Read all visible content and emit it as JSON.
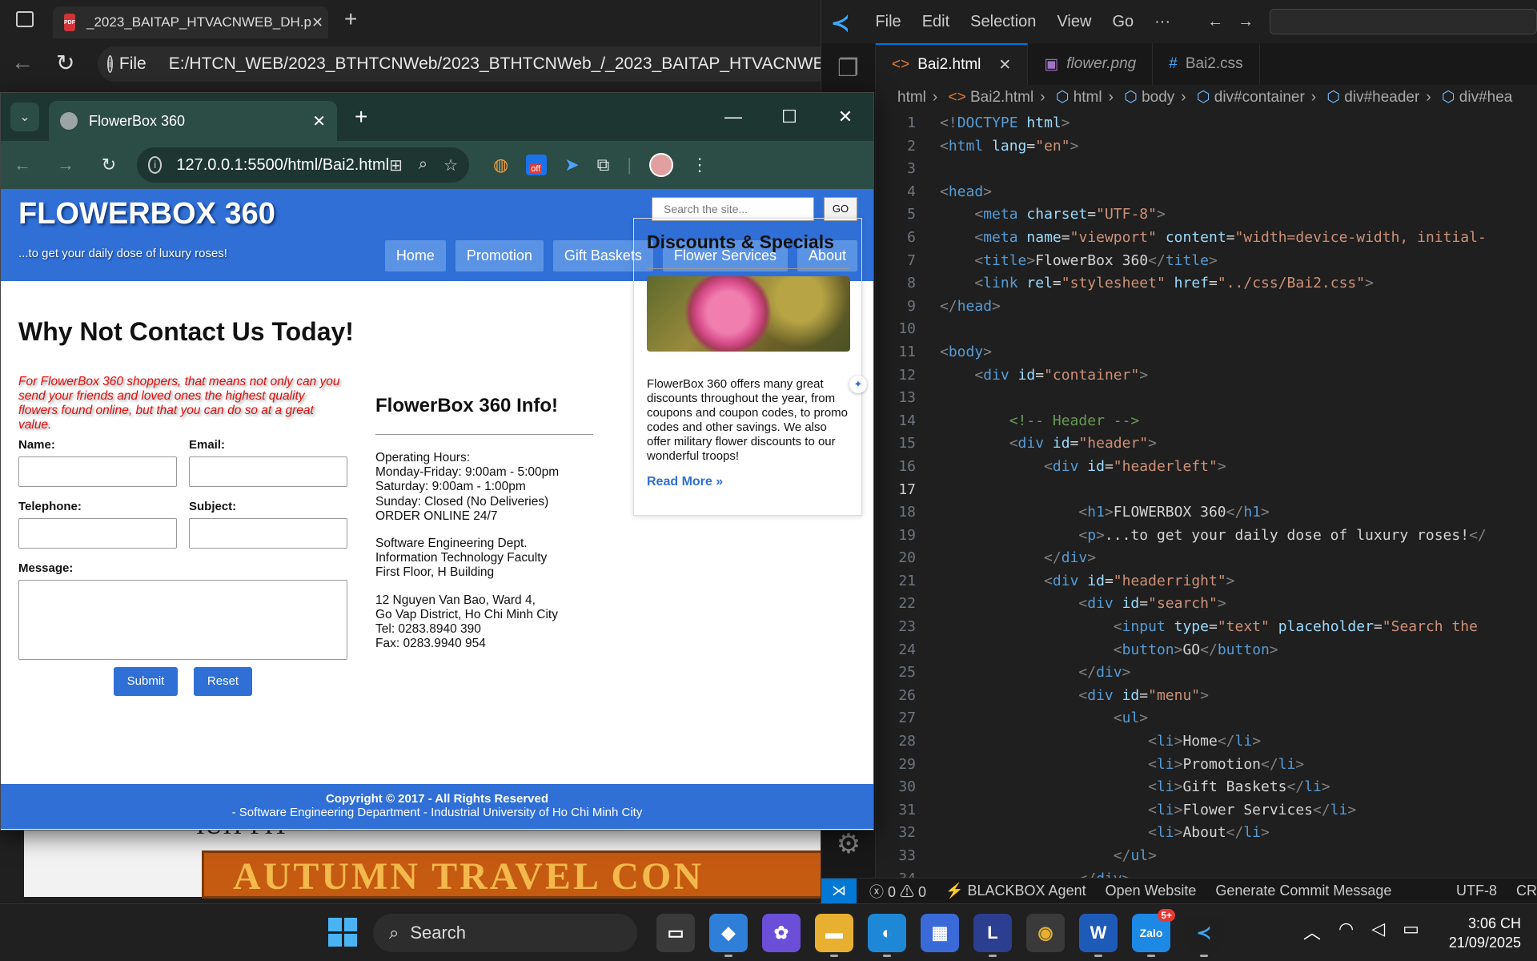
{
  "edge_bg": {
    "tab_title": "_2023_BAITAP_HTVACNWEB_DH.p",
    "pdf_badge": "PDF",
    "address": "E:/HTCN_WEB/2023_BTHTCNWeb/2023_BTHTCNWeb_/_2023_BAITAP_HTVACNWEB_DH.p",
    "address_prefix": "File",
    "pdf_text_fragment": "IUH-FIT",
    "pdf_banner": "AUTUMN TRAVEL CON"
  },
  "chrome": {
    "tab_title": "FlowerBox 360",
    "url": "127.0.0.1:5500/html/Bai2.html",
    "ext_badge": "off"
  },
  "site": {
    "title": "FLOWERBOX 360",
    "tagline": "...to get your daily dose of luxury roses!",
    "search_placeholder": "Search the site...",
    "go_label": "GO",
    "menu": [
      "Home",
      "Promotion",
      "Gift Baskets",
      "Flower Services",
      "About"
    ],
    "heading": "Why Not Contact Us Today!",
    "intro": "For FlowerBox 360 shoppers, that means not only can you send your friends and loved ones the highest quality flowers found online, but that you can do so at a great value.",
    "form": {
      "name_label": "Name:",
      "email_label": "Email:",
      "telephone_label": "Telephone:",
      "subject_label": "Subject:",
      "message_label": "Message:",
      "submit": "Submit",
      "reset": "Reset"
    },
    "info_title": "FlowerBox 360 Info!",
    "hours": [
      "Operating Hours:",
      "Monday-Friday: 9:00am - 5:00pm",
      "Saturday: 9:00am - 1:00pm",
      "Sunday: Closed (No Deliveries)",
      "ORDER ONLINE 24/7"
    ],
    "dept": [
      "Software Engineering Dept.",
      "Information Technology Faculty",
      "First Floor, H Building"
    ],
    "address": [
      "12 Nguyen Van Bao, Ward 4,",
      "Go Vap District, Ho Chi Minh City",
      "Tel: 0283.8940 390",
      "Fax: 0283.9940 954"
    ],
    "side_title": "Discounts & Specials",
    "side_text": "FlowerBox 360 offers many great discounts throughout the year, from coupons and coupon codes, to promo codes and other savings. We also offer military flower discounts to our wonderful troops!",
    "read_more": "Read More »",
    "footer_line1": "Copyright © 2017 - All Rights Reserved",
    "footer_line2": "- Software Engineering Department - Industrial University of Ho Chi Minh City"
  },
  "vscode": {
    "menu": [
      "File",
      "Edit",
      "Selection",
      "View",
      "Go",
      "···"
    ],
    "tabs": [
      {
        "label": "Bai2.html",
        "icon": "<>"
      },
      {
        "label": "flower.png",
        "icon": "▣"
      },
      {
        "label": "Bai2.css",
        "icon": "#"
      }
    ],
    "breadcrumb": [
      "html",
      "Bai2.html",
      "html",
      "body",
      "div#container",
      "div#header",
      "div#hea"
    ],
    "current_line": 17,
    "status": {
      "errors": "0",
      "warnings": "0",
      "agent": "BLACKBOX Agent",
      "open_website": "Open Website",
      "commit": "Generate Commit Message",
      "encoding": "UTF-8",
      "eol": "CR"
    },
    "code": [
      {
        "n": 1,
        "s": [
          [
            "br",
            "<!"
          ],
          [
            "tag",
            "DOCTYPE"
          ],
          [
            "txt",
            " "
          ],
          [
            "attr",
            "html"
          ],
          [
            "br",
            ">"
          ]
        ]
      },
      {
        "n": 2,
        "s": [
          [
            "br",
            "<"
          ],
          [
            "tag",
            "html"
          ],
          [
            "txt",
            " "
          ],
          [
            "attr",
            "lang"
          ],
          [
            "txt",
            "="
          ],
          [
            "str",
            "\"en\""
          ],
          [
            "br",
            ">"
          ]
        ]
      },
      {
        "n": 3,
        "s": []
      },
      {
        "n": 4,
        "s": [
          [
            "br",
            "<"
          ],
          [
            "tag",
            "head"
          ],
          [
            "br",
            ">"
          ]
        ]
      },
      {
        "n": 5,
        "s": [
          [
            "txt",
            "    "
          ],
          [
            "br",
            "<"
          ],
          [
            "tag",
            "meta"
          ],
          [
            "txt",
            " "
          ],
          [
            "attr",
            "charset"
          ],
          [
            "txt",
            "="
          ],
          [
            "str",
            "\"UTF-8\""
          ],
          [
            "br",
            ">"
          ]
        ]
      },
      {
        "n": 6,
        "s": [
          [
            "txt",
            "    "
          ],
          [
            "br",
            "<"
          ],
          [
            "tag",
            "meta"
          ],
          [
            "txt",
            " "
          ],
          [
            "attr",
            "name"
          ],
          [
            "txt",
            "="
          ],
          [
            "str",
            "\"viewport\""
          ],
          [
            "txt",
            " "
          ],
          [
            "attr",
            "content"
          ],
          [
            "txt",
            "="
          ],
          [
            "str",
            "\"width=device-width, initial-"
          ]
        ]
      },
      {
        "n": 7,
        "s": [
          [
            "txt",
            "    "
          ],
          [
            "br",
            "<"
          ],
          [
            "tag",
            "title"
          ],
          [
            "br",
            ">"
          ],
          [
            "txt",
            "FlowerBox 360"
          ],
          [
            "br",
            "</"
          ],
          [
            "tag",
            "title"
          ],
          [
            "br",
            ">"
          ]
        ]
      },
      {
        "n": 8,
        "s": [
          [
            "txt",
            "    "
          ],
          [
            "br",
            "<"
          ],
          [
            "tag",
            "link"
          ],
          [
            "txt",
            " "
          ],
          [
            "attr",
            "rel"
          ],
          [
            "txt",
            "="
          ],
          [
            "str",
            "\"stylesheet\""
          ],
          [
            "txt",
            " "
          ],
          [
            "attr",
            "href"
          ],
          [
            "txt",
            "="
          ],
          [
            "str",
            "\"../css/Bai2.css\""
          ],
          [
            "br",
            ">"
          ]
        ]
      },
      {
        "n": 9,
        "s": [
          [
            "br",
            "</"
          ],
          [
            "tag",
            "head"
          ],
          [
            "br",
            ">"
          ]
        ]
      },
      {
        "n": 10,
        "s": []
      },
      {
        "n": 11,
        "s": [
          [
            "br",
            "<"
          ],
          [
            "tag",
            "body"
          ],
          [
            "br",
            ">"
          ]
        ]
      },
      {
        "n": 12,
        "s": [
          [
            "txt",
            "    "
          ],
          [
            "br",
            "<"
          ],
          [
            "tag",
            "div"
          ],
          [
            "txt",
            " "
          ],
          [
            "attr",
            "id"
          ],
          [
            "txt",
            "="
          ],
          [
            "str",
            "\"container\""
          ],
          [
            "br",
            ">"
          ]
        ]
      },
      {
        "n": 13,
        "s": []
      },
      {
        "n": 14,
        "s": [
          [
            "txt",
            "        "
          ],
          [
            "cm",
            "<!-- Header -->"
          ]
        ]
      },
      {
        "n": 15,
        "s": [
          [
            "txt",
            "        "
          ],
          [
            "br",
            "<"
          ],
          [
            "tag",
            "div"
          ],
          [
            "txt",
            " "
          ],
          [
            "attr",
            "id"
          ],
          [
            "txt",
            "="
          ],
          [
            "str",
            "\"header\""
          ],
          [
            "br",
            ">"
          ]
        ]
      },
      {
        "n": 16,
        "s": [
          [
            "txt",
            "            "
          ],
          [
            "br",
            "<"
          ],
          [
            "tag",
            "div"
          ],
          [
            "txt",
            " "
          ],
          [
            "attr",
            "id"
          ],
          [
            "txt",
            "="
          ],
          [
            "str",
            "\"headerleft\""
          ],
          [
            "br",
            ">"
          ]
        ]
      },
      {
        "n": 17,
        "s": []
      },
      {
        "n": 18,
        "s": [
          [
            "txt",
            "                "
          ],
          [
            "br",
            "<"
          ],
          [
            "tag",
            "h1"
          ],
          [
            "br",
            ">"
          ],
          [
            "txt",
            "FLOWERBOX 360"
          ],
          [
            "br",
            "</"
          ],
          [
            "tag",
            "h1"
          ],
          [
            "br",
            ">"
          ]
        ]
      },
      {
        "n": 19,
        "s": [
          [
            "txt",
            "                "
          ],
          [
            "br",
            "<"
          ],
          [
            "tag",
            "p"
          ],
          [
            "br",
            ">"
          ],
          [
            "txt",
            "...to get your daily dose of luxury roses!"
          ],
          [
            "br",
            "</"
          ]
        ]
      },
      {
        "n": 20,
        "s": [
          [
            "txt",
            "            "
          ],
          [
            "br",
            "</"
          ],
          [
            "tag",
            "div"
          ],
          [
            "br",
            ">"
          ]
        ]
      },
      {
        "n": 21,
        "s": [
          [
            "txt",
            "            "
          ],
          [
            "br",
            "<"
          ],
          [
            "tag",
            "div"
          ],
          [
            "txt",
            " "
          ],
          [
            "attr",
            "id"
          ],
          [
            "txt",
            "="
          ],
          [
            "str",
            "\"headerright\""
          ],
          [
            "br",
            ">"
          ]
        ]
      },
      {
        "n": 22,
        "s": [
          [
            "txt",
            "                "
          ],
          [
            "br",
            "<"
          ],
          [
            "tag",
            "div"
          ],
          [
            "txt",
            " "
          ],
          [
            "attr",
            "id"
          ],
          [
            "txt",
            "="
          ],
          [
            "str",
            "\"search\""
          ],
          [
            "br",
            ">"
          ]
        ]
      },
      {
        "n": 23,
        "s": [
          [
            "txt",
            "                    "
          ],
          [
            "br",
            "<"
          ],
          [
            "tag",
            "input"
          ],
          [
            "txt",
            " "
          ],
          [
            "attr",
            "type"
          ],
          [
            "txt",
            "="
          ],
          [
            "str",
            "\"text\""
          ],
          [
            "txt",
            " "
          ],
          [
            "attr",
            "placeholder"
          ],
          [
            "txt",
            "="
          ],
          [
            "str",
            "\"Search the"
          ]
        ]
      },
      {
        "n": 24,
        "s": [
          [
            "txt",
            "                    "
          ],
          [
            "br",
            "<"
          ],
          [
            "tag",
            "button"
          ],
          [
            "br",
            ">"
          ],
          [
            "txt",
            "GO"
          ],
          [
            "br",
            "</"
          ],
          [
            "tag",
            "button"
          ],
          [
            "br",
            ">"
          ]
        ]
      },
      {
        "n": 25,
        "s": [
          [
            "txt",
            "                "
          ],
          [
            "br",
            "</"
          ],
          [
            "tag",
            "div"
          ],
          [
            "br",
            ">"
          ]
        ]
      },
      {
        "n": 26,
        "s": [
          [
            "txt",
            "                "
          ],
          [
            "br",
            "<"
          ],
          [
            "tag",
            "div"
          ],
          [
            "txt",
            " "
          ],
          [
            "attr",
            "id"
          ],
          [
            "txt",
            "="
          ],
          [
            "str",
            "\"menu\""
          ],
          [
            "br",
            ">"
          ]
        ]
      },
      {
        "n": 27,
        "s": [
          [
            "txt",
            "                    "
          ],
          [
            "br",
            "<"
          ],
          [
            "tag",
            "ul"
          ],
          [
            "br",
            ">"
          ]
        ]
      },
      {
        "n": 28,
        "s": [
          [
            "txt",
            "                        "
          ],
          [
            "br",
            "<"
          ],
          [
            "tag",
            "li"
          ],
          [
            "br",
            ">"
          ],
          [
            "txt",
            "Home"
          ],
          [
            "br",
            "</"
          ],
          [
            "tag",
            "li"
          ],
          [
            "br",
            ">"
          ]
        ]
      },
      {
        "n": 29,
        "s": [
          [
            "txt",
            "                        "
          ],
          [
            "br",
            "<"
          ],
          [
            "tag",
            "li"
          ],
          [
            "br",
            ">"
          ],
          [
            "txt",
            "Promotion"
          ],
          [
            "br",
            "</"
          ],
          [
            "tag",
            "li"
          ],
          [
            "br",
            ">"
          ]
        ]
      },
      {
        "n": 30,
        "s": [
          [
            "txt",
            "                        "
          ],
          [
            "br",
            "<"
          ],
          [
            "tag",
            "li"
          ],
          [
            "br",
            ">"
          ],
          [
            "txt",
            "Gift Baskets"
          ],
          [
            "br",
            "</"
          ],
          [
            "tag",
            "li"
          ],
          [
            "br",
            ">"
          ]
        ]
      },
      {
        "n": 31,
        "s": [
          [
            "txt",
            "                        "
          ],
          [
            "br",
            "<"
          ],
          [
            "tag",
            "li"
          ],
          [
            "br",
            ">"
          ],
          [
            "txt",
            "Flower Services"
          ],
          [
            "br",
            "</"
          ],
          [
            "tag",
            "li"
          ],
          [
            "br",
            ">"
          ]
        ]
      },
      {
        "n": 32,
        "s": [
          [
            "txt",
            "                        "
          ],
          [
            "br",
            "<"
          ],
          [
            "tag",
            "li"
          ],
          [
            "br",
            ">"
          ],
          [
            "txt",
            "About"
          ],
          [
            "br",
            "</"
          ],
          [
            "tag",
            "li"
          ],
          [
            "br",
            ">"
          ]
        ]
      },
      {
        "n": 33,
        "s": [
          [
            "txt",
            "                    "
          ],
          [
            "br",
            "</"
          ],
          [
            "tag",
            "ul"
          ],
          [
            "br",
            ">"
          ]
        ]
      },
      {
        "n": 34,
        "s": [
          [
            "txt",
            "                "
          ],
          [
            "br",
            "</"
          ],
          [
            "tag",
            "div"
          ],
          [
            "br",
            ">"
          ]
        ]
      }
    ]
  },
  "taskbar": {
    "search_label": "Search",
    "zalo_badge": "5+",
    "time": "3:06 CH",
    "date": "21/09/2025"
  }
}
